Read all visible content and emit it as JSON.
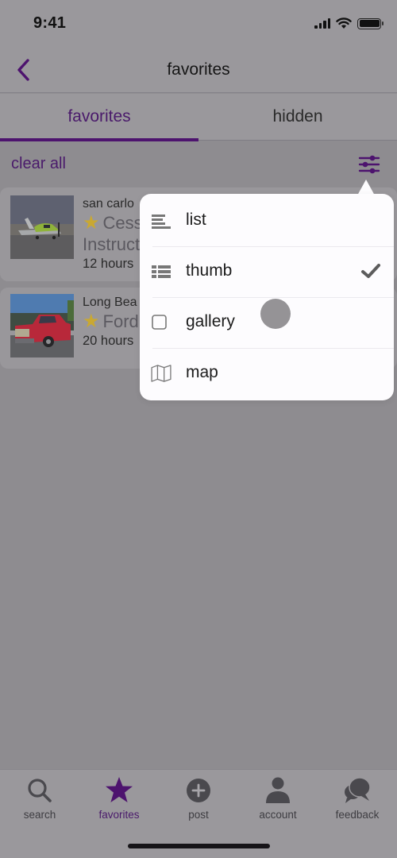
{
  "status_bar": {
    "time": "9:41",
    "icons": [
      "cellular-signal-icon",
      "wifi-icon",
      "battery-icon"
    ]
  },
  "nav": {
    "title": "favorites",
    "back_icon": "chevron-left-icon"
  },
  "tabs": [
    {
      "label": "favorites",
      "active": true
    },
    {
      "label": "hidden",
      "active": false
    }
  ],
  "toolbar": {
    "clear_all_label": "clear all",
    "filter_icon": "sliders-icon"
  },
  "listings": [
    {
      "location": "san carlo",
      "title": "Cess",
      "subtitle": "Instruct",
      "time": "12 hours",
      "favorited": true,
      "image": "airplane-photo"
    },
    {
      "location": "Long Bea",
      "title": "Ford",
      "subtitle": "",
      "time": "20 hours",
      "favorited": true,
      "image": "red-pickup-truck-photo"
    }
  ],
  "view_menu": {
    "items": [
      {
        "label": "list",
        "icon": "list-icon",
        "selected": false
      },
      {
        "label": "thumb",
        "icon": "thumb-list-icon",
        "selected": true
      },
      {
        "label": "gallery",
        "icon": "gallery-square-icon",
        "selected": false
      },
      {
        "label": "map",
        "icon": "map-icon",
        "selected": false
      }
    ]
  },
  "tab_bar": {
    "items": [
      {
        "label": "search",
        "icon": "search-icon",
        "active": false
      },
      {
        "label": "favorites",
        "icon": "star-icon",
        "active": true
      },
      {
        "label": "post",
        "icon": "plus-circle-icon",
        "active": false
      },
      {
        "label": "account",
        "icon": "person-icon",
        "active": false
      },
      {
        "label": "feedback",
        "icon": "chat-bubbles-icon",
        "active": false
      }
    ]
  },
  "colors": {
    "accent": "#4d136e",
    "star": "#c9a832",
    "dim_overlay": "#8e8c90"
  }
}
